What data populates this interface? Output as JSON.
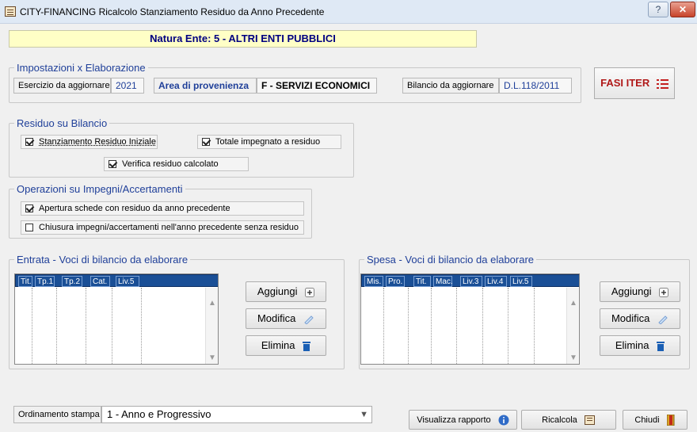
{
  "window": {
    "title": "CITY-FINANCING  Ricalcolo Stanziamento Residuo da Anno Precedente",
    "help_glyph": "?",
    "close_glyph": "✕"
  },
  "banner": {
    "text": "Natura Ente:   5 - ALTRI ENTI PUBBLICI"
  },
  "impostazioni": {
    "legend": "Impostazioni x Elaborazione",
    "esercizio_label": "Esercizio da aggiornare",
    "esercizio_value": "2021",
    "area_label": "Area di provenienza",
    "area_value": "F  - SERVIZI ECONOMICI",
    "bilancio_label": "Bilancio da aggiornare",
    "bilancio_value": "D.L.118/2011"
  },
  "fasi_iter": {
    "label": "FASI ITER"
  },
  "residuo": {
    "legend": "Residuo su Bilancio",
    "items": [
      {
        "label": "Stanziamento Residuo Iniziale",
        "checked": true
      },
      {
        "label": "Totale impegnato a residuo",
        "checked": true
      },
      {
        "label": "Verifica residuo calcolato",
        "checked": true
      }
    ]
  },
  "operazioni": {
    "legend": "Operazioni su Impegni/Accertamenti",
    "items": [
      {
        "label": "Apertura schede con residuo da anno precedente",
        "checked": true
      },
      {
        "label": "Chiusura impegni/accertamenti nell'anno precedente senza residuo",
        "checked": false
      }
    ]
  },
  "entrata": {
    "legend": "Entrata - Voci di bilancio da elaborare",
    "columns": [
      "Tit.",
      "Tp.1",
      "Tp.2",
      "Cat.",
      "Liv.5"
    ],
    "add_label": "Aggiungi",
    "edit_label": "Modifica",
    "delete_label": "Elimina"
  },
  "spesa": {
    "legend": "Spesa - Voci di bilancio da elaborare",
    "columns": [
      "Mis.",
      "Pro.",
      "Tit.",
      "Mac.",
      "Liv.3",
      "Liv.4",
      "Liv.5"
    ],
    "add_label": "Aggiungi",
    "edit_label": "Modifica",
    "delete_label": "Elimina"
  },
  "footer": {
    "ordinamento_label": "Ordinamento stampa",
    "ordinamento_value": "1 - Anno e Progressivo",
    "visualizza_label": "Visualizza rapporto",
    "ricalcola_label": "Ricalcola",
    "chiudi_label": "Chiudi"
  },
  "colors": {
    "accent_blue": "#1f3f99",
    "grid_header": "#1a4f96",
    "banner_bg": "#ffffc6",
    "fasi_red": "#b01818"
  }
}
